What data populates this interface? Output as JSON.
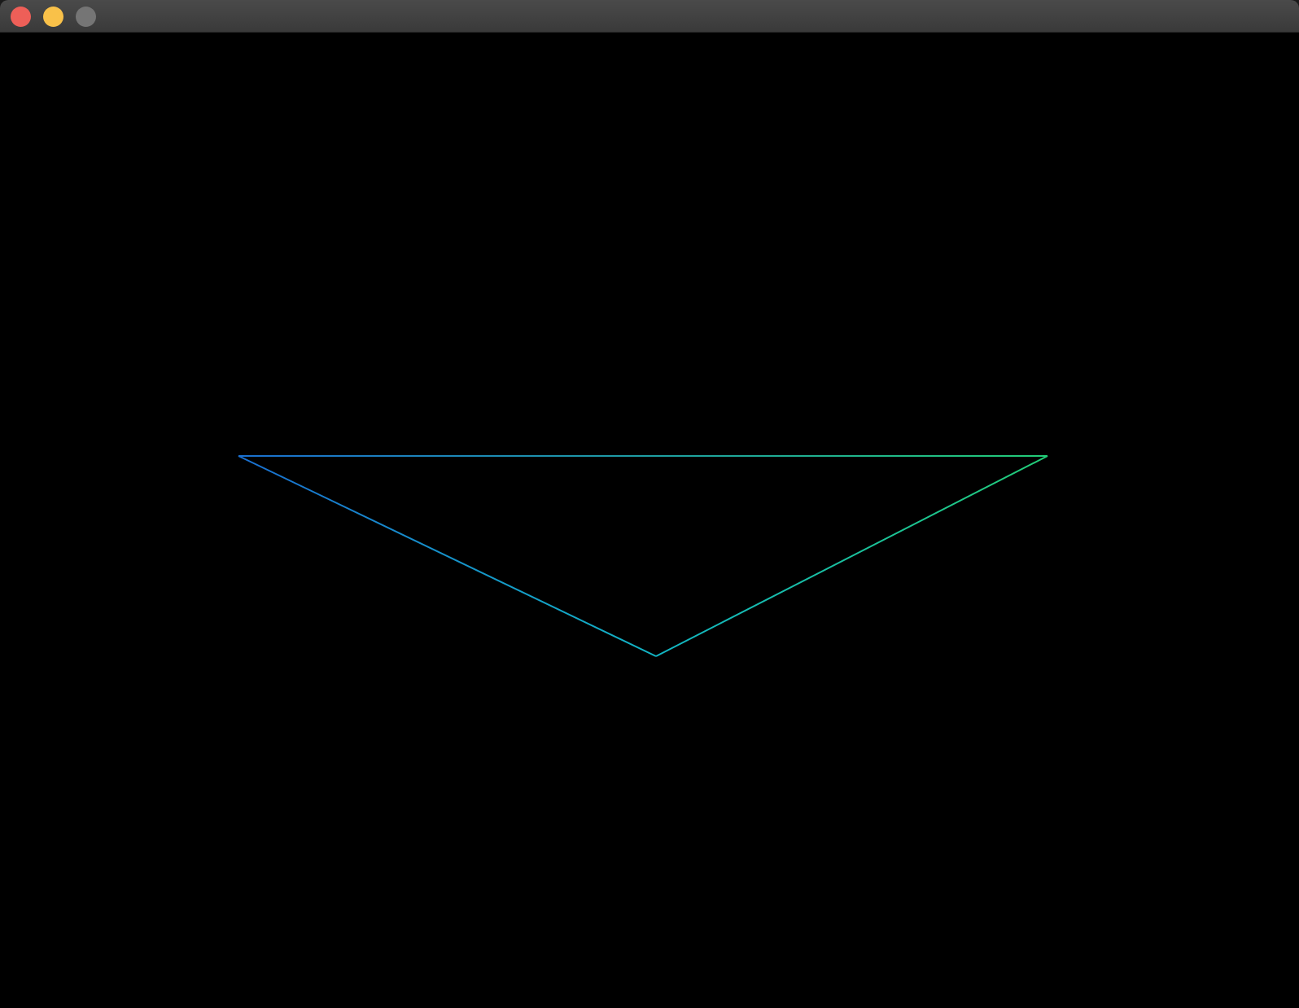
{
  "window": {
    "title": "",
    "controls": {
      "close": {
        "color": "#ee5f58"
      },
      "minimize": {
        "color": "#f9c149"
      },
      "zoom": {
        "color": "#757575"
      }
    }
  },
  "canvas": {
    "background": "#000000",
    "shape": "triangle-outline",
    "colors": {
      "left_vertex": "#1a6fd0",
      "right_vertex": "#22cc77",
      "bottom_vertex": "#12b5c4"
    }
  }
}
